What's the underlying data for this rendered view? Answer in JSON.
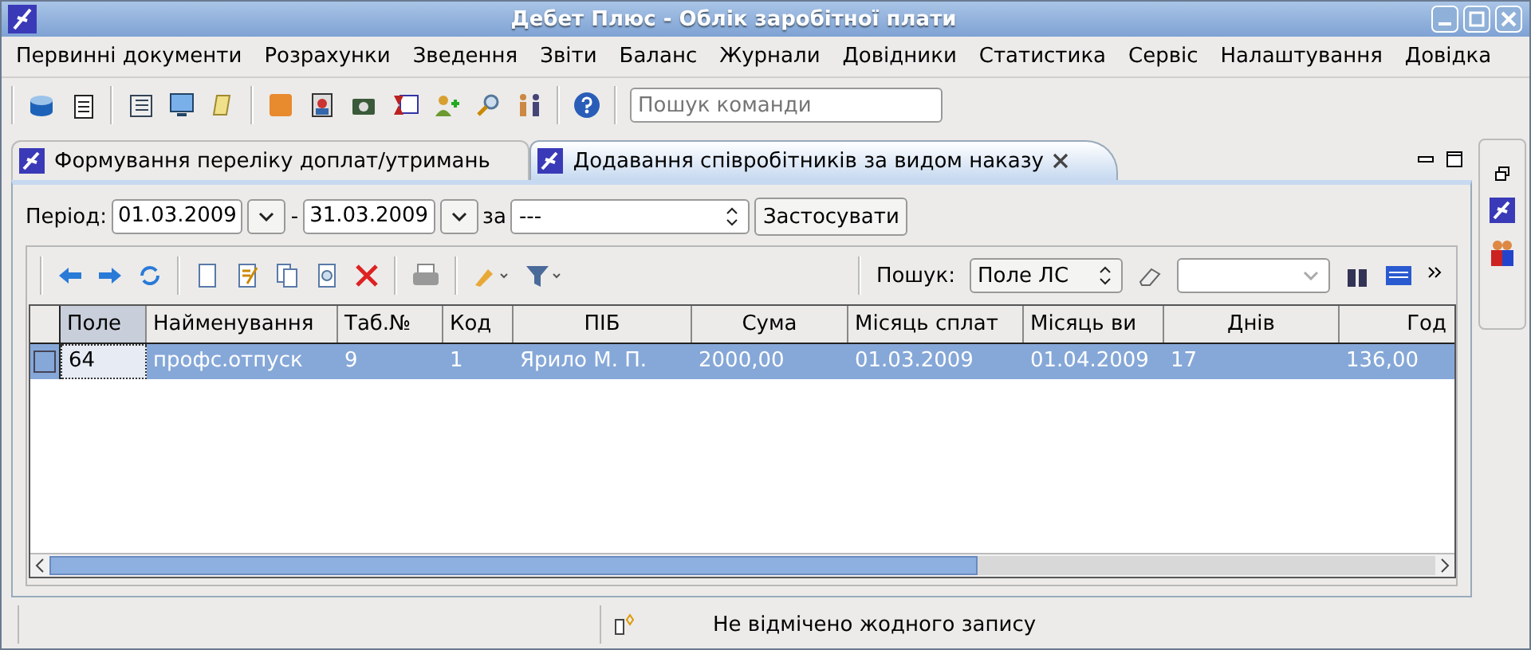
{
  "window": {
    "title": "Дебет Плюс - Облік заробітної плати"
  },
  "menu": [
    "Первинні документи",
    "Розрахунки",
    "Зведення",
    "Звіти",
    "Баланс",
    "Журнали",
    "Довідники",
    "Статистика",
    "Сервіс",
    "Налаштування",
    "Довідка"
  ],
  "toolbar": {
    "search": {
      "placeholder": "Пошук команди"
    }
  },
  "tabs": [
    {
      "label": "Формування переліку доплат/утримань",
      "selected": false
    },
    {
      "label": "Додавання співробітників за видом наказу",
      "selected": true
    }
  ],
  "period": {
    "label": "Період:",
    "from": "01.03.2009",
    "separator": "-",
    "to": "31.03.2009",
    "for_label": "за",
    "for_value": "---",
    "apply": "Застосувати"
  },
  "search": {
    "label": "Пошук:",
    "field": "Поле ЛС"
  },
  "table": {
    "columns": [
      "Поле",
      "Найменування",
      "Таб.№",
      "Код",
      "ПІБ",
      "Сума",
      "Місяць сплат",
      "Місяць ви",
      "Днів",
      "Год"
    ],
    "rows": [
      {
        "cells": [
          "64",
          "профс.отпуск",
          "9",
          "1",
          "Ярило М. П.",
          "2000,00",
          "01.03.2009",
          "01.04.2009",
          "17",
          "136,00"
        ],
        "selected": true
      }
    ]
  },
  "status_bar": {
    "text": "Не відмічено жодного запису"
  }
}
